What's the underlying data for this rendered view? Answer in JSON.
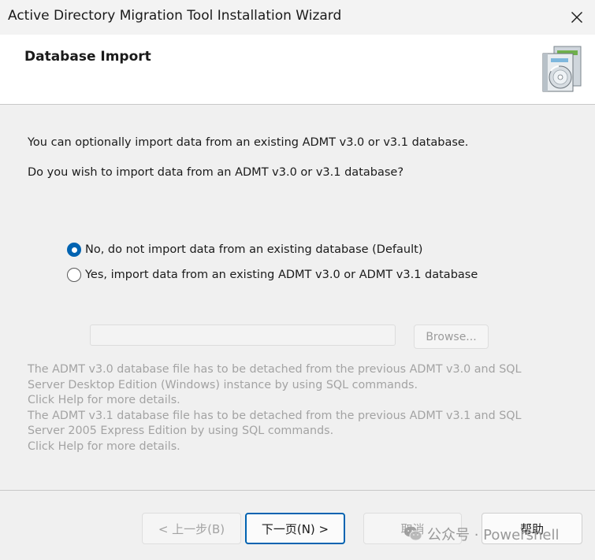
{
  "window": {
    "title": "Active Directory Migration Tool Installation Wizard",
    "close_icon": "close-icon"
  },
  "header": {
    "title": "Database Import",
    "icon": "installer-disc-icon"
  },
  "content": {
    "intro": "You can optionally import data from an existing ADMT v3.0 or v3.1 database.",
    "question": "Do you wish to import data from an ADMT v3.0 or v3.1 database?",
    "options": [
      {
        "label": "No, do not import data from an existing database (Default)",
        "selected": true
      },
      {
        "label": "Yes, import data from an existing ADMT v3.0 or ADMT v3.1 database",
        "selected": false
      }
    ],
    "path_input": {
      "value": "",
      "enabled": false
    },
    "browse_label": "Browse...",
    "notes": [
      "The ADMT v3.0 database file has to be detached from the previous ADMT v3.0 and SQL",
      "Server Desktop Edition (Windows) instance by using SQL commands.",
      "Click Help for more details.",
      "The ADMT v3.1 database file has to be detached from the previous ADMT v3.1 and SQL",
      "Server 2005 Express Edition by using SQL commands.",
      "Click Help for more details."
    ]
  },
  "footer": {
    "back_label": "< 上一步(B)",
    "next_label": "下一页(N) >",
    "cancel_label": "取消",
    "help_label": "帮助"
  },
  "watermark": {
    "text": "公众号 · Powershell"
  },
  "colors": {
    "accent": "#0063b1",
    "disabled_text": "#a3a3a3",
    "window_bg": "#f0f0f0",
    "header_bg": "#ffffff"
  }
}
